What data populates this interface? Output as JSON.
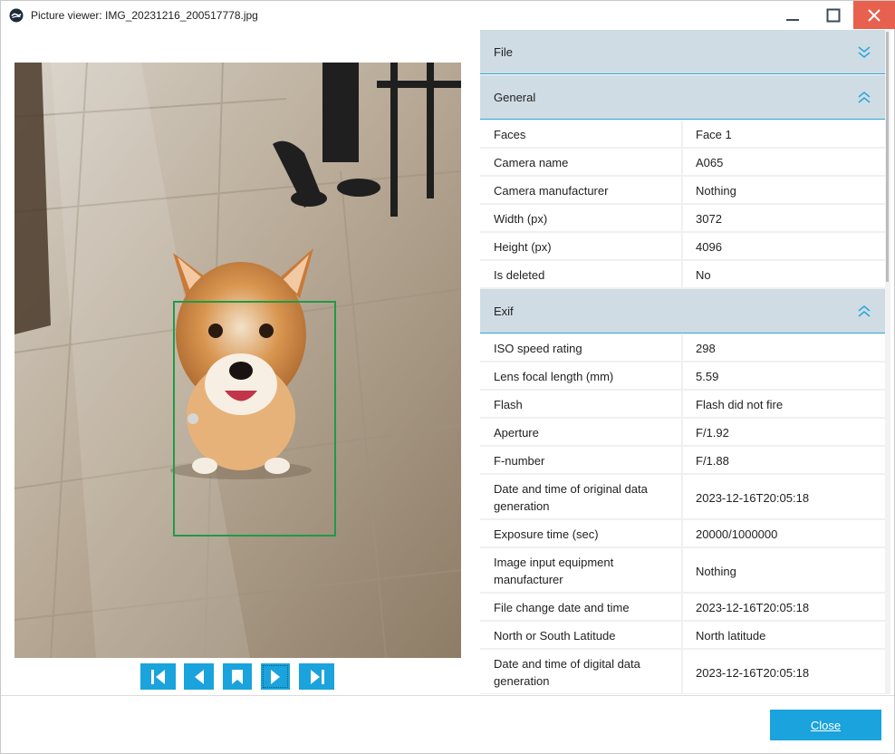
{
  "window": {
    "title": "Picture viewer: IMG_20231216_200517778.jpg"
  },
  "photo": {
    "description_icon": "dog-photo",
    "face_label": "Face 1"
  },
  "navigation": {
    "first": "first-image",
    "prev": "previous-image",
    "bookmark": "bookmark",
    "next": "next-image",
    "last": "last-image"
  },
  "sections": {
    "file": {
      "label": "File",
      "expanded": false
    },
    "general": {
      "label": "General",
      "expanded": true,
      "rows": [
        {
          "key": "Faces",
          "value": "Face 1"
        },
        {
          "key": "Camera name",
          "value": "A065"
        },
        {
          "key": "Camera manufacturer",
          "value": "Nothing"
        },
        {
          "key": "Width (px)",
          "value": "3072"
        },
        {
          "key": "Height (px)",
          "value": "4096"
        },
        {
          "key": "Is deleted",
          "value": "No"
        }
      ]
    },
    "exif": {
      "label": "Exif",
      "expanded": true,
      "rows": [
        {
          "key": "ISO speed rating",
          "value": "298"
        },
        {
          "key": "Lens focal length (mm)",
          "value": "5.59"
        },
        {
          "key": "Flash",
          "value": "Flash did not fire"
        },
        {
          "key": "Aperture",
          "value": "F/1.92"
        },
        {
          "key": "F-number",
          "value": "F/1.88"
        },
        {
          "key": "Date and time of original data generation",
          "value": "2023-12-16T20:05:18"
        },
        {
          "key": "Exposure time (sec)",
          "value": "20000/1000000"
        },
        {
          "key": "Image input equipment manufacturer",
          "value": "Nothing"
        },
        {
          "key": "File change date and time",
          "value": "2023-12-16T20:05:18"
        },
        {
          "key": "North or South Latitude",
          "value": "North latitude"
        },
        {
          "key": "Date and time of digital data generation",
          "value": "2023-12-16T20:05:18"
        }
      ]
    }
  },
  "footer": {
    "close_label": "Close"
  },
  "colors": {
    "accent": "#1aa3dc",
    "header_bg": "#d0dce3",
    "close_hover": "#e8604e",
    "face_box": "#1f9a4a"
  }
}
